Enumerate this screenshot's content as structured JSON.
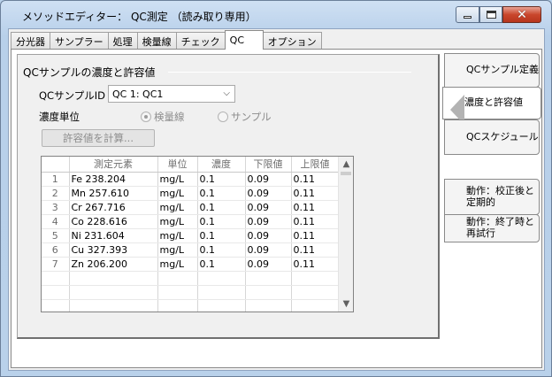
{
  "window": {
    "title": "メソッドエディター： QC測定 （読み取り専用）"
  },
  "tabs": [
    {
      "label": "分光器"
    },
    {
      "label": "サンプラー"
    },
    {
      "label": "処理"
    },
    {
      "label": "検量線"
    },
    {
      "label": "チェック"
    },
    {
      "label": "QC"
    },
    {
      "label": "オプション"
    }
  ],
  "active_tab": "QC",
  "section": {
    "title": "QCサンプルの濃度と許容値"
  },
  "qc_sample": {
    "label": "QCサンプルID",
    "selected": "QC 1: QC1"
  },
  "concentration_unit": {
    "label": "濃度単位",
    "options": [
      {
        "label": "検量線",
        "selected": true
      },
      {
        "label": "サンプル",
        "selected": false
      }
    ]
  },
  "calc_button": {
    "label": "許容値を計算..."
  },
  "grid": {
    "columns": [
      "",
      "測定元素",
      "単位",
      "濃度",
      "下限値",
      "上限値"
    ],
    "rows": [
      {
        "n": "1",
        "element": "Fe 238.204",
        "unit": "mg/L",
        "conc": "0.1",
        "low": "0.09",
        "high": "0.11"
      },
      {
        "n": "2",
        "element": "Mn 257.610",
        "unit": "mg/L",
        "conc": "0.1",
        "low": "0.09",
        "high": "0.11"
      },
      {
        "n": "3",
        "element": "Cr 267.716",
        "unit": "mg/L",
        "conc": "0.1",
        "low": "0.09",
        "high": "0.11"
      },
      {
        "n": "4",
        "element": "Co 228.616",
        "unit": "mg/L",
        "conc": "0.1",
        "low": "0.09",
        "high": "0.11"
      },
      {
        "n": "5",
        "element": "Ni 231.604",
        "unit": "mg/L",
        "conc": "0.1",
        "low": "0.09",
        "high": "0.11"
      },
      {
        "n": "6",
        "element": "Cu 327.393",
        "unit": "mg/L",
        "conc": "0.1",
        "low": "0.09",
        "high": "0.11"
      },
      {
        "n": "7",
        "element": "Zn 206.200",
        "unit": "mg/L",
        "conc": "0.1",
        "low": "0.09",
        "high": "0.11"
      }
    ]
  },
  "side_tabs": [
    {
      "label": "QCサンプル定義"
    },
    {
      "label": "濃度と許容値"
    },
    {
      "label": "QCスケジュール"
    },
    {
      "label": "動作：校正後と定期的"
    },
    {
      "label": "動作：終了時と再試行"
    }
  ],
  "icons": {
    "minimize": "minimize-icon",
    "maximize": "maximize-icon",
    "close": "close-icon",
    "dropdown": "chevron-down-icon",
    "scroll_up": "scroll-up-icon",
    "scroll_down": "scroll-down-icon",
    "active_side": "triangle-left-icon"
  },
  "colors": {
    "titlebar": "#b9d1ea",
    "close_button": "#c9462c",
    "disabled_text": "#8d8d8d"
  }
}
